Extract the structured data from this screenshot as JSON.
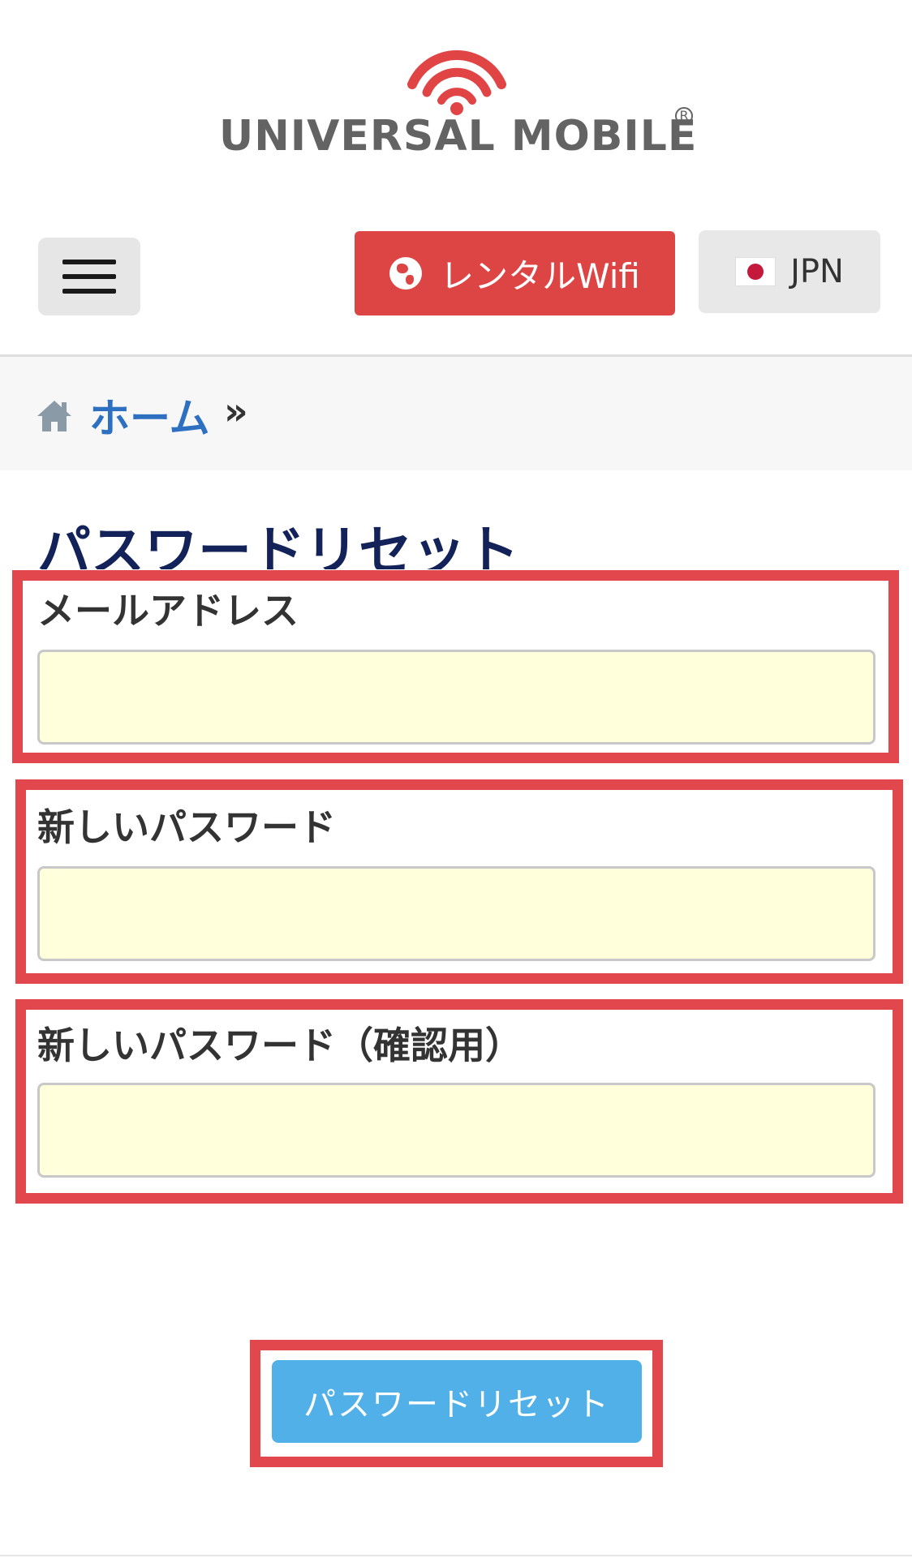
{
  "logo": {
    "brand_text": "UNIVERSAL MOBILE",
    "registered_mark": "R"
  },
  "header": {
    "rental_label": "レンタルWifi",
    "language_label": "JPN",
    "accent_color": "#dd4444"
  },
  "breadcrumb": {
    "home_label": "ホーム",
    "separator": "»"
  },
  "page": {
    "title": "パスワードリセット"
  },
  "form": {
    "email_label": "メールアドレス",
    "email_value": "",
    "new_password_label": "新しいパスワード",
    "new_password_value": "",
    "confirm_password_label": "新しいパスワード（確認用）",
    "confirm_password_value": "",
    "input_bg_color": "#ffffdc",
    "highlight_color": "#e2474e",
    "submit_label": "パスワードリセット",
    "submit_color": "#52b0e8"
  }
}
